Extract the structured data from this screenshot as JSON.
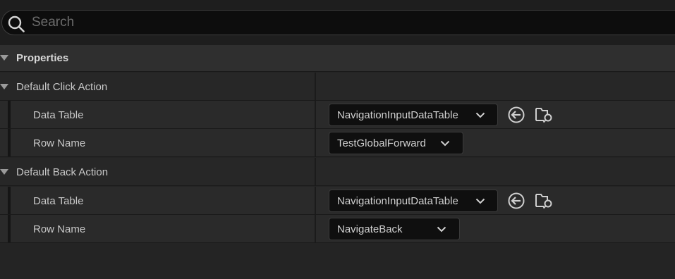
{
  "search": {
    "placeholder": "Search",
    "value": ""
  },
  "section": {
    "title": "Properties"
  },
  "categories": [
    {
      "title": "Default Click Action",
      "properties": [
        {
          "label": "Data Table",
          "value": "NavigationInputDataTable",
          "icons": [
            "use-selected-icon",
            "browse-asset-icon"
          ]
        },
        {
          "label": "Row Name",
          "value": "TestGlobalForward"
        }
      ]
    },
    {
      "title": "Default Back Action",
      "properties": [
        {
          "label": "Data Table",
          "value": "NavigationInputDataTable",
          "icons": [
            "use-selected-icon",
            "browse-asset-icon"
          ]
        },
        {
          "label": "Row Name",
          "value": "NavigateBack"
        }
      ]
    }
  ],
  "colors": {
    "background": "#242424",
    "field": "#0f0f0f",
    "text": "#c8c8c8"
  }
}
